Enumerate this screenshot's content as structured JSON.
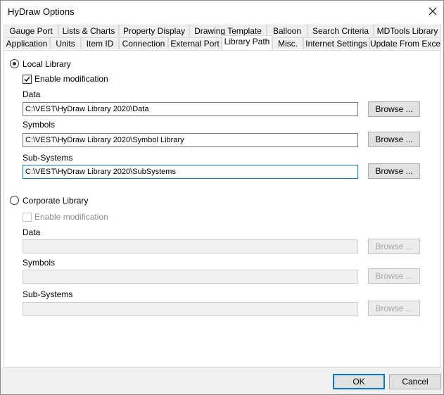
{
  "window": {
    "title": "HyDraw Options"
  },
  "tabs": {
    "row1": [
      "Gauge Port",
      "Lists & Charts",
      "Property Display",
      "Drawing Template",
      "Balloon",
      "Search Criteria",
      "MDTools Library"
    ],
    "row2": [
      "Application",
      "Units",
      "Item ID",
      "Connection",
      "External Port",
      "Library Path",
      "Misc.",
      "Internet Settings",
      "Update From Excel"
    ],
    "active": "Library Path"
  },
  "local": {
    "label": "Local Library",
    "selected": true,
    "enable_mod_label": "Enable modification",
    "enable_mod_checked": true,
    "data_label": "Data",
    "data_value": "C:\\VEST\\HyDraw Library 2020\\Data",
    "symbols_label": "Symbols",
    "symbols_value": "C:\\VEST\\HyDraw Library 2020\\Symbol Library",
    "subsystems_label": "Sub-Systems",
    "subsystems_value": "C:\\VEST\\HyDraw Library 2020\\SubSystems",
    "browse_label": "Browse ..."
  },
  "corporate": {
    "label": "Corporate Library",
    "selected": false,
    "enable_mod_label": "Enable modification",
    "enable_mod_checked": false,
    "data_label": "Data",
    "data_value": "",
    "symbols_label": "Symbols",
    "symbols_value": "",
    "subsystems_label": "Sub-Systems",
    "subsystems_value": "",
    "browse_label": "Browse ..."
  },
  "footer": {
    "ok_label": "OK",
    "cancel_label": "Cancel"
  },
  "colors": {
    "accent": "#0078d7",
    "footer_bg": "#f0f0f0",
    "disabled_text": "#8d8d8d"
  }
}
